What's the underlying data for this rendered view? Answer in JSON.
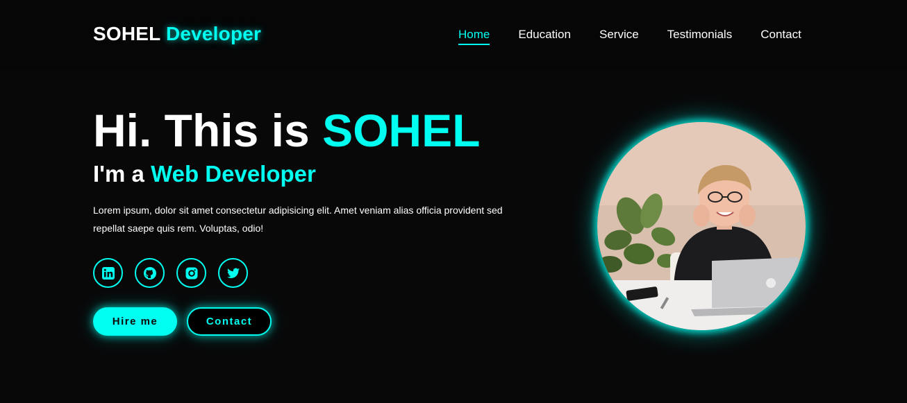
{
  "brand": {
    "name": "SOHEL",
    "accent": "Developer"
  },
  "nav": {
    "items": [
      {
        "label": "Home",
        "active": true
      },
      {
        "label": "Education"
      },
      {
        "label": "Service"
      },
      {
        "label": "Testimonials"
      },
      {
        "label": "Contact"
      }
    ]
  },
  "hero": {
    "greeting": "Hi. This is ",
    "name": "SOHEL",
    "role_prefix": "I'm a ",
    "role": "Web Developer",
    "description": "Lorem ipsum, dolor sit amet consectetur adipisicing elit. Amet veniam alias officia provident sed repellat saepe quis rem. Voluptas, odio!"
  },
  "socials": [
    {
      "icon": "linkedin-icon"
    },
    {
      "icon": "github-icon"
    },
    {
      "icon": "instagram-icon"
    },
    {
      "icon": "twitter-icon"
    }
  ],
  "buttons": {
    "hire": "Hire me",
    "contact": "Contact"
  },
  "colors": {
    "accent": "#00fff0",
    "background": "#080809",
    "text": "#ffffff"
  }
}
